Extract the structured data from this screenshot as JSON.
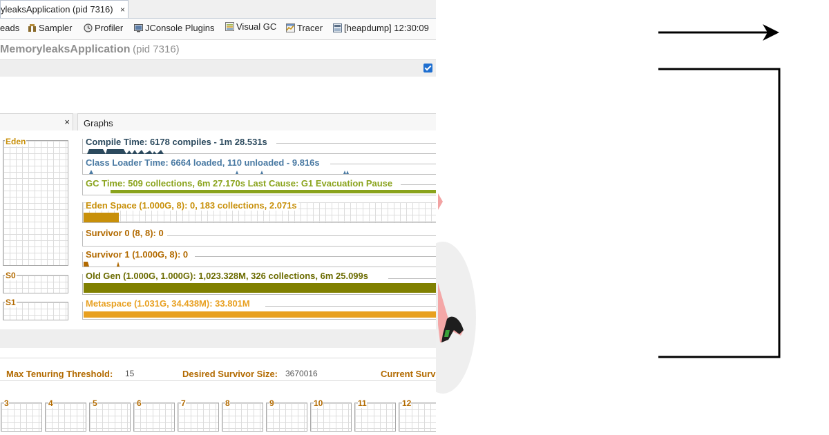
{
  "tab": {
    "title": "yleaksApplication (pid 7316)",
    "close": "×"
  },
  "toolbar": {
    "items": [
      {
        "label": "eads"
      },
      {
        "label": "Sampler",
        "icon": "sampler-icon"
      },
      {
        "label": "Profiler",
        "icon": "profiler-icon"
      },
      {
        "label": "JConsole Plugins",
        "icon": "jconsole-icon"
      },
      {
        "label": "Visual GC",
        "icon": "visualgc-icon"
      },
      {
        "label": "Tracer",
        "icon": "tracer-icon"
      },
      {
        "label": "[heapdump] 12:30:09",
        "icon": "heapdump-icon"
      }
    ]
  },
  "header": {
    "app_name": "MemoryleaksApplication",
    "pid": "(pid 7316)"
  },
  "left_panel": {
    "close": "×",
    "eden": "Eden",
    "s0": "S0",
    "s1": "S1"
  },
  "graphs_panel": {
    "title": "Graphs",
    "rows": [
      {
        "label": "Compile Time: 6178 compiles - 1m 28.531s",
        "color": "#2c4a5e"
      },
      {
        "label": "Class Loader Time: 6664 loaded, 110 unloaded - 9.816s",
        "color": "#4a7aa3"
      },
      {
        "label": "GC Time: 509 collections, 6m 27.170s  Last Cause: G1 Evacuation Pause",
        "color": "#8aa31c"
      },
      {
        "label": "Eden Space (1.000G, 8): 0, 183 collections, 2.071s",
        "color": "#c8900a",
        "fill": 0.1
      },
      {
        "label": "Survivor 0 (8, 8): 0",
        "color": "#b26a00",
        "fill": 0
      },
      {
        "label": "Survivor 1 (1.000G, 8): 0",
        "color": "#b26a00",
        "fill": 0
      },
      {
        "label": "Old Gen (1.000G, 1.000G): 1,023.328M, 326 collections, 6m 25.099s",
        "color": "#6b6b00",
        "fill": 1.0
      },
      {
        "label": "Metaspace (1.031G, 34.438M): 33.801M",
        "color": "#e8a020",
        "fill": 1.0
      }
    ]
  },
  "info": {
    "max_tenuring_label": "Max Tenuring Threshold:",
    "max_tenuring_value": "15",
    "desired_survivor_label": "Desired Survivor Size:",
    "desired_survivor_value": "3670016",
    "current_surv_label": "Current Surv"
  },
  "ages": [
    "3",
    "4",
    "5",
    "6",
    "7",
    "8",
    "9",
    "10",
    "11",
    "12"
  ]
}
